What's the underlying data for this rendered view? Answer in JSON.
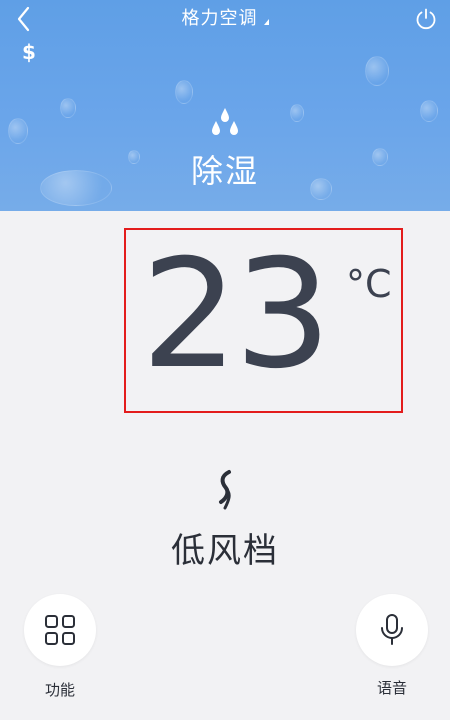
{
  "header": {
    "title": "格力空调",
    "mode": {
      "label": "除湿",
      "icon": "water-drops-icon"
    },
    "icons": {
      "back": "chevron-left-icon",
      "power": "power-icon",
      "dollar": "$"
    }
  },
  "temperature": {
    "value": "23",
    "unit": "°C"
  },
  "fan": {
    "label": "低风档",
    "icon": "fan-icon"
  },
  "bottom": {
    "function_label": "功能",
    "voice_label": "语音"
  },
  "colors": {
    "header_bg": "#6aa5ea",
    "body_bg": "#f2f2f4",
    "highlight_border": "#e31c1c",
    "text_dark": "#3c4250"
  }
}
